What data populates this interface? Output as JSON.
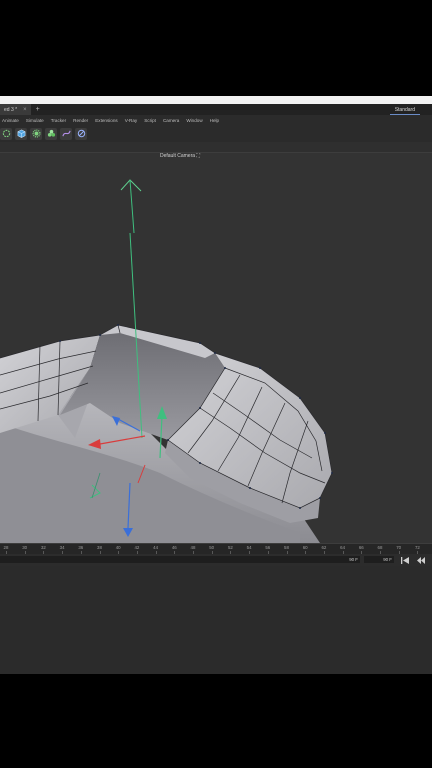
{
  "tabs": [
    {
      "label": "ed 3 *"
    }
  ],
  "tab_add": "+",
  "tab_close": "×",
  "layout": {
    "label": "Standard"
  },
  "menu": [
    "Animate",
    "Simulate",
    "Tracker",
    "Render",
    "Extensions",
    "V-Ray",
    "Script",
    "Camera",
    "Window",
    "Help"
  ],
  "toolbar_icons": [
    "loop-selection-icon",
    "cube-icon",
    "gear-icon",
    "cluster-icon",
    "spline-icon",
    "deformer-icon"
  ],
  "viewport": {
    "camera_label": "Default Camera",
    "camera_icon": "⛶"
  },
  "timeline": {
    "ticks": [
      "28",
      "30",
      "32",
      "34",
      "36",
      "38",
      "40",
      "42",
      "44",
      "46",
      "48",
      "50",
      "52",
      "54",
      "56",
      "58",
      "60",
      "62",
      "64",
      "66",
      "68",
      "70",
      "72"
    ]
  },
  "transport": {
    "start_frame": "90 F",
    "end_frame": "90 F"
  },
  "colors": {
    "y_axis": "#3fbf7f",
    "x_axis": "#d93c3c",
    "z_axis": "#3a6fd9",
    "mesh": "#bdbdc2",
    "accent": "#6a8cc7"
  }
}
